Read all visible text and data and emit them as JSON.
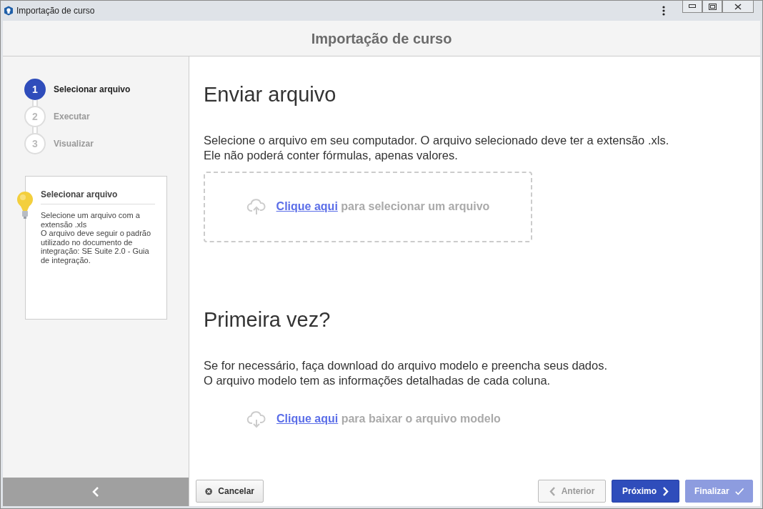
{
  "window": {
    "title": "Importação de curso"
  },
  "header": {
    "title": "Importação de curso"
  },
  "steps": [
    {
      "number": "1",
      "label": "Selecionar arquivo",
      "selected": true
    },
    {
      "number": "2",
      "label": "Executar",
      "selected": false
    },
    {
      "number": "3",
      "label": "Visualizar",
      "selected": false
    }
  ],
  "help_card": {
    "title": "Selecionar arquivo",
    "lines": [
      "Selecione um arquivo com a extensão .xls",
      "O arquivo deve seguir o padrão utilizado no documento de integração: SE Suite 2.0 - Guia de integração."
    ]
  },
  "sections": [
    {
      "kind": "upload",
      "heading": "Enviar arquivo",
      "lines": [
        "Selecione o arquivo em seu computador. O arquivo selecionado deve ter a extensão .xls.",
        "Ele não poderá conter fórmulas, apenas valores."
      ],
      "link": "Clique aqui",
      "rest": "para selecionar um arquivo"
    },
    {
      "kind": "download",
      "heading": "Primeira vez?",
      "lines": [
        "Se for necessário, faça download do arquivo modelo e preencha seus dados.",
        "O arquivo modelo tem as informações detalhadas de cada coluna."
      ],
      "link": "Clique aqui",
      "rest": "para baixar o arquivo modelo"
    }
  ],
  "footer": {
    "buttons": [
      {
        "kind": "cancel",
        "label": "Cancelar",
        "disabled": false
      },
      {
        "kind": "previous",
        "label": "Anterior",
        "disabled": true
      },
      {
        "kind": "next",
        "label": "Próximo",
        "disabled": false
      },
      {
        "kind": "finish",
        "label": "Finalizar",
        "disabled": true
      }
    ]
  }
}
